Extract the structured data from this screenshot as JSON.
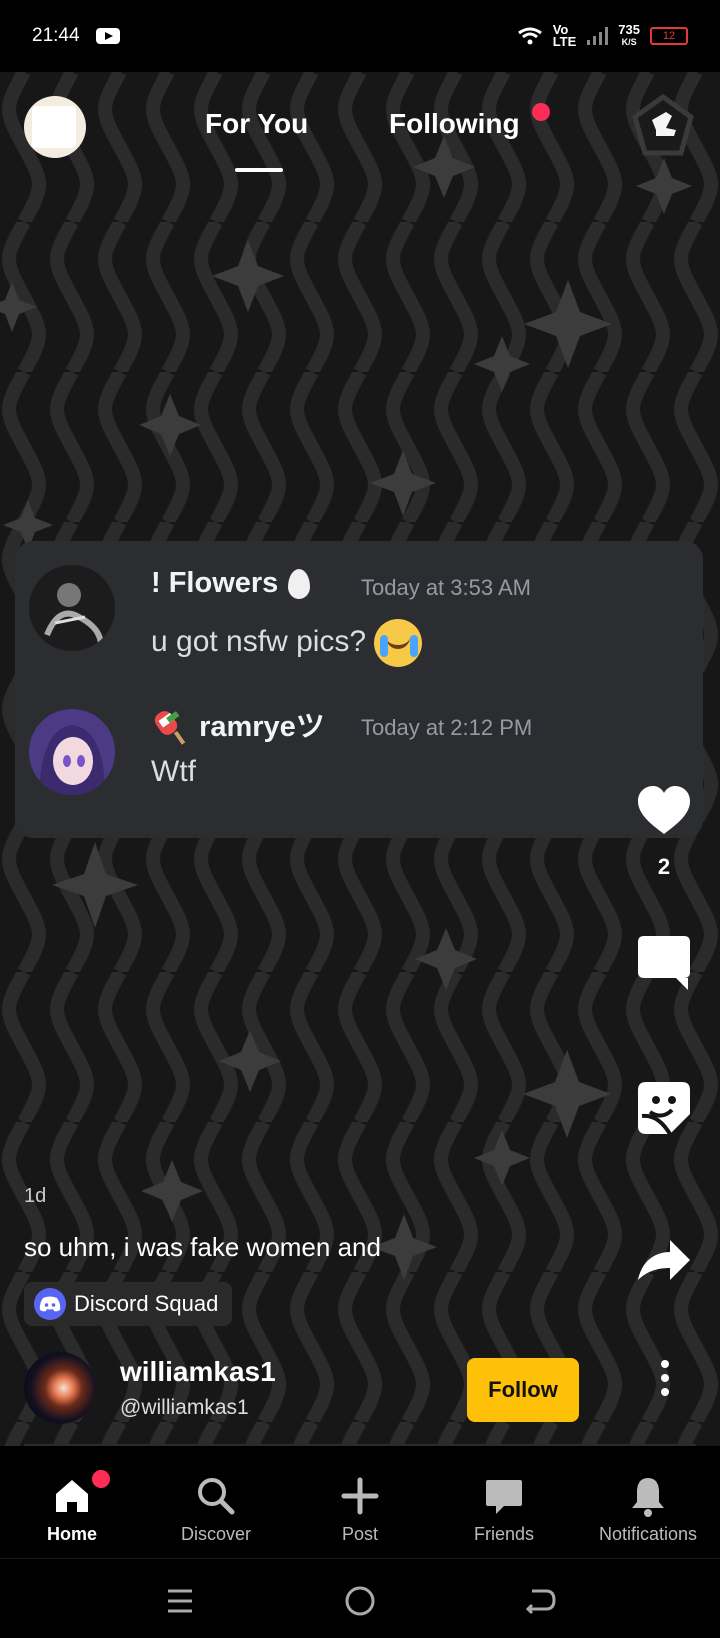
{
  "status": {
    "time": "21:44",
    "network_top": "Vo",
    "network_bottom": "LTE",
    "speed_value": "735",
    "speed_unit": "K/S",
    "battery": "12"
  },
  "tabs": {
    "for_you": "For You",
    "following": "Following"
  },
  "post": {
    "messages": [
      {
        "author": "! Flowers",
        "time": "Today at 3:53 AM",
        "text": "u got nsfw pics?"
      },
      {
        "author": "ramryeツ",
        "time": "Today at 2:12 PM",
        "text": "Wtf"
      }
    ],
    "age": "1d",
    "caption": "so uhm, i was fake women and",
    "tag": "Discord Squad",
    "author_name": "williamkas1",
    "author_handle": "@williamkas1",
    "follow_label": "Follow",
    "like_count": "2"
  },
  "nav": {
    "home": "Home",
    "discover": "Discover",
    "post": "Post",
    "friends": "Friends",
    "notifications": "Notifications"
  },
  "colors": {
    "accent": "#ffc107",
    "notification_dot": "#ff2d55",
    "card_bg": "#2b2d31"
  }
}
